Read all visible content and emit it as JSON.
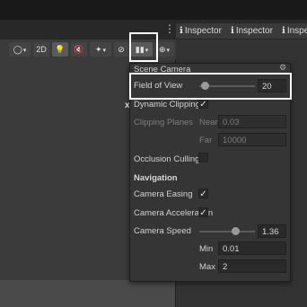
{
  "tabs": [
    {
      "icon": "info-icon",
      "glyph": "ℹ",
      "label": "Inspector"
    },
    {
      "icon": "info-icon",
      "glyph": "ℹ",
      "label": "Inspector"
    },
    {
      "icon": "info-icon",
      "glyph": "ℹ",
      "label": "Inspe"
    }
  ],
  "toolbar": {
    "mode_2d": "2D",
    "dropdown_arrow": "▾"
  },
  "gizmo_axis": "x",
  "scene_camera": {
    "title": "Scene Camera",
    "field_of_view": {
      "label": "Field of View",
      "value": "20",
      "level": 0.1
    },
    "dynamic_clipping": {
      "label": "Dynamic Clipping",
      "checked": true
    },
    "clipping_planes": {
      "label": "Clipping Planes",
      "near_label": "Near",
      "near_value": "0.03",
      "far_label": "Far",
      "far_value": "10000"
    },
    "occlusion_culling": {
      "label": "Occlusion Culling",
      "checked": false
    },
    "navigation": {
      "heading": "Navigation",
      "camera_easing": {
        "label": "Camera Easing",
        "checked": true
      },
      "camera_acceleration": {
        "label": "Camera Acceleration",
        "checked": true
      },
      "camera_speed": {
        "label": "Camera Speed",
        "value": "1.36",
        "level": 0.65
      },
      "min": {
        "label": "Min",
        "value": "0.01"
      },
      "max": {
        "label": "Max",
        "value": "2"
      }
    }
  },
  "check_glyph": "✓",
  "colors": {
    "highlight": "#ffffff",
    "panel": "#353535",
    "field": "#2a2a2a"
  }
}
